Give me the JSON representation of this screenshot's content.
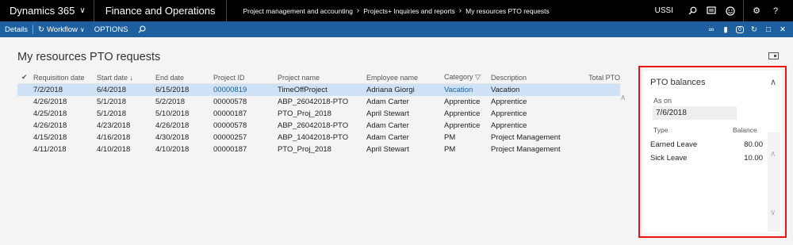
{
  "topbar": {
    "brand": "Dynamics 365",
    "app": "Finance and Operations",
    "breadcrumbs": [
      "Project management and accounting",
      "Projects+ Inquiries and reports",
      "My resources PTO requests"
    ],
    "company": "USSI",
    "icons": [
      "search-icon",
      "message-icon",
      "smiley-icon",
      "gear-icon",
      "help-icon"
    ]
  },
  "actionbar": {
    "details": "Details",
    "workflow": "Workflow",
    "options": "OPTIONS",
    "right_icons": [
      "link-icon",
      "office-icon",
      "notification-icon",
      "refresh-icon",
      "popout-icon",
      "close-icon"
    ],
    "notification_count": "0"
  },
  "page": {
    "title": "My resources PTO requests"
  },
  "grid": {
    "columns": {
      "req": "Requisition date",
      "start": "Start date",
      "end": "End date",
      "proj": "Project ID",
      "name": "Project name",
      "emp": "Employee name",
      "cat": "Category",
      "desc": "Description",
      "total": "Total PTO"
    },
    "rows": [
      {
        "req": "7/2/2018",
        "start": "6/4/2018",
        "end": "6/15/2018",
        "proj": "00000819",
        "name": "TimeOffProject",
        "emp": "Adriana Giorgi",
        "cat": "Vacation",
        "desc": "Vacation"
      },
      {
        "req": "4/26/2018",
        "start": "5/1/2018",
        "end": "5/2/2018",
        "proj": "00000578",
        "name": "ABP_26042018-PTO",
        "emp": "Adam Carter",
        "cat": "Apprentice",
        "desc": "Apprentice"
      },
      {
        "req": "4/25/2018",
        "start": "5/1/2018",
        "end": "5/10/2018",
        "proj": "00000187",
        "name": "PTO_Proj_2018",
        "emp": "April Stewart",
        "cat": "Apprentice",
        "desc": "Apprentice"
      },
      {
        "req": "4/26/2018",
        "start": "4/23/2018",
        "end": "4/26/2018",
        "proj": "00000578",
        "name": "ABP_26042018-PTO",
        "emp": "Adam Carter",
        "cat": "Apprentice",
        "desc": "Apprentice"
      },
      {
        "req": "4/15/2018",
        "start": "4/16/2018",
        "end": "4/30/2018",
        "proj": "00000257",
        "name": "ABP_14042018-PTO",
        "emp": "Adam Carter",
        "cat": "PM",
        "desc": "Project Management"
      },
      {
        "req": "4/11/2018",
        "start": "4/10/2018",
        "end": "4/10/2018",
        "proj": "00000187",
        "name": "PTO_Proj_2018",
        "emp": "April Stewart",
        "cat": "PM",
        "desc": "Project Management"
      }
    ]
  },
  "pto_panel": {
    "title": "PTO balances",
    "as_on_label": "As on",
    "as_on_value": "7/6/2018",
    "type_header": "Type",
    "balance_header": "Balance",
    "rows": [
      {
        "type": "Earned Leave",
        "balance": "80.00"
      },
      {
        "type": "Sick Leave",
        "balance": "10.00"
      }
    ]
  },
  "colors": {
    "topbar": "#000000",
    "actionbar": "#1e5fa0",
    "selected_row": "#cfe2f5",
    "highlight_border": "#ee1111"
  }
}
